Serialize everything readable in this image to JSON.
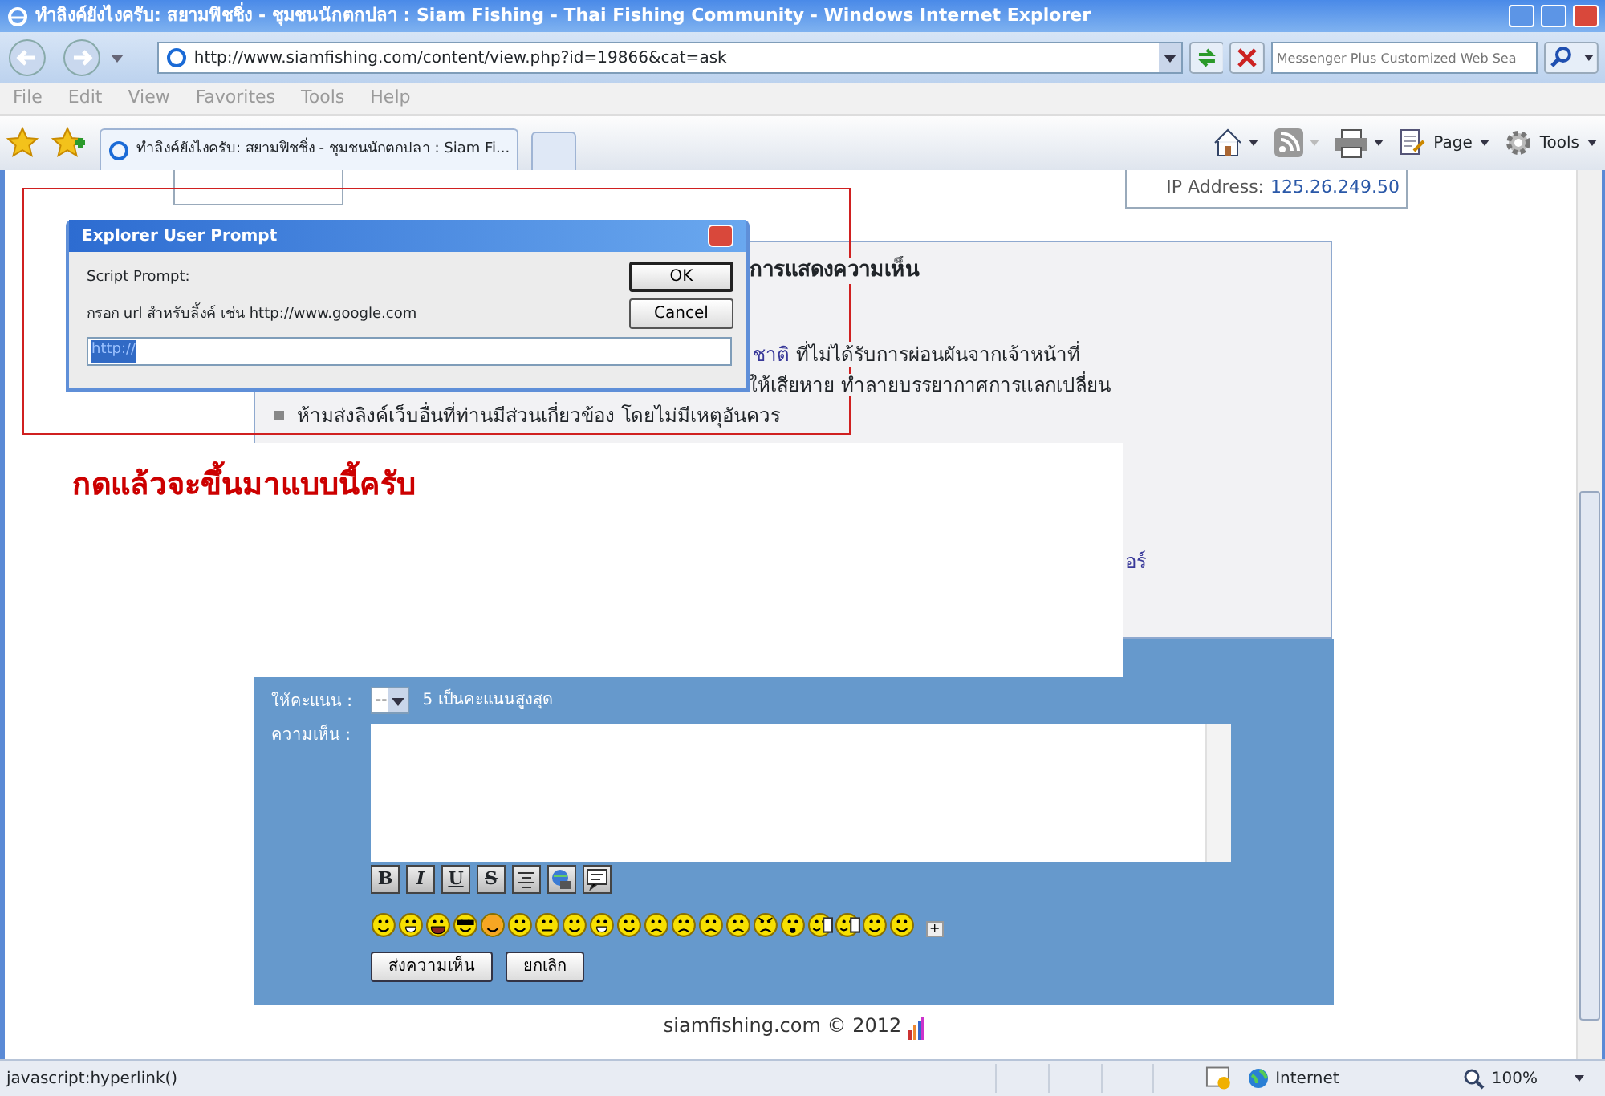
{
  "window": {
    "title": "ทำลิงค์ยังไงครับ: สยามฟิชชิ่ง - ชุมชนนักตกปลา : Siam Fishing - Thai Fishing Community - Windows Internet Explorer"
  },
  "address_bar": {
    "url": "http://www.siamfishing.com/content/view.php?id=19866&cat=ask"
  },
  "search": {
    "placeholder": "Messenger Plus Customized Web Sea"
  },
  "menu": [
    {
      "label": "File",
      "disabled": true
    },
    {
      "label": "Edit",
      "disabled": true
    },
    {
      "label": "View",
      "disabled": true
    },
    {
      "label": "Favorites",
      "disabled": true
    },
    {
      "label": "Tools",
      "disabled": true
    },
    {
      "label": "Help",
      "disabled": true
    }
  ],
  "tabs": [
    {
      "label": "ทำลิงค์ยังไงครับ: สยามฟิชชิ่ง - ชุมชนนักตกปลา : Siam Fi...",
      "selected": true
    }
  ],
  "command_bar": [
    {
      "label": "Page"
    },
    {
      "label": "Tools"
    }
  ],
  "page": {
    "ip_label": "IP Address:",
    "ip_value": "125.26.249.50",
    "rules": {
      "heading": "การแสดงความเห็น",
      "lines": [
        {
          "kind": "continued",
          "link": "ชาติ",
          "text": "ที่ไม่ได้รับการผ่อนผันจากเจ้าหน้าที่"
        },
        {
          "kind": "plain",
          "text": "ให้เสียหาย ทำลายบรรยากาศการแลกเปลี่ยน"
        },
        {
          "kind": "bullet",
          "text": "ห้ามส่งลิงค์เว็บอื่นที่ท่านมีส่วนเกี่ยวข้อง โดยไม่มีเหตุอันควร"
        },
        {
          "kind": "link",
          "link": "อร์"
        }
      ]
    }
  },
  "annotation": {
    "text": "กดแล้วจะขึ้นมาแบบนี้ครับ"
  },
  "dialog": {
    "title": "Explorer User Prompt",
    "label": "Script Prompt:",
    "message": "กรอก url สำหรับลิ้งค์ เช่น http://www.google.com",
    "value": "http://",
    "buttons": [
      "OK",
      "Cancel"
    ]
  },
  "form": {
    "rating_label": "ให้คะแนน :",
    "rating_value": "--",
    "rating_hint": "5 เป็นคะแนนสูงสุด",
    "comment_label": "ความเห็น :",
    "format_buttons": [
      {
        "kind": "bold",
        "label": "B"
      },
      {
        "kind": "italic",
        "label": "I"
      },
      {
        "kind": "underline",
        "label": "U"
      },
      {
        "kind": "strike",
        "label": "S"
      },
      {
        "kind": "center"
      },
      {
        "kind": "link"
      },
      {
        "kind": "quote"
      }
    ],
    "smileys": [
      {
        "kind": "smile"
      },
      {
        "kind": "grin"
      },
      {
        "kind": "laugh"
      },
      {
        "kind": "cool"
      },
      {
        "kind": "blush"
      },
      {
        "kind": "smile"
      },
      {
        "kind": "wink"
      },
      {
        "kind": "smile"
      },
      {
        "kind": "grin"
      },
      {
        "kind": "smile"
      },
      {
        "kind": "frown"
      },
      {
        "kind": "frown"
      },
      {
        "kind": "frown"
      },
      {
        "kind": "frown"
      },
      {
        "kind": "angry"
      },
      {
        "kind": "surprised"
      },
      {
        "kind": "drink"
      },
      {
        "kind": "drink"
      },
      {
        "kind": "smile"
      },
      {
        "kind": "smile"
      }
    ],
    "more": "+",
    "buttons": [
      "ส่งความเห็น",
      "ยกเลิก"
    ]
  },
  "footer": "siamfishing.com © 2012",
  "status_bar": {
    "text": "javascript:hyperlink()",
    "zone": "Internet",
    "zoom": "100%"
  }
}
